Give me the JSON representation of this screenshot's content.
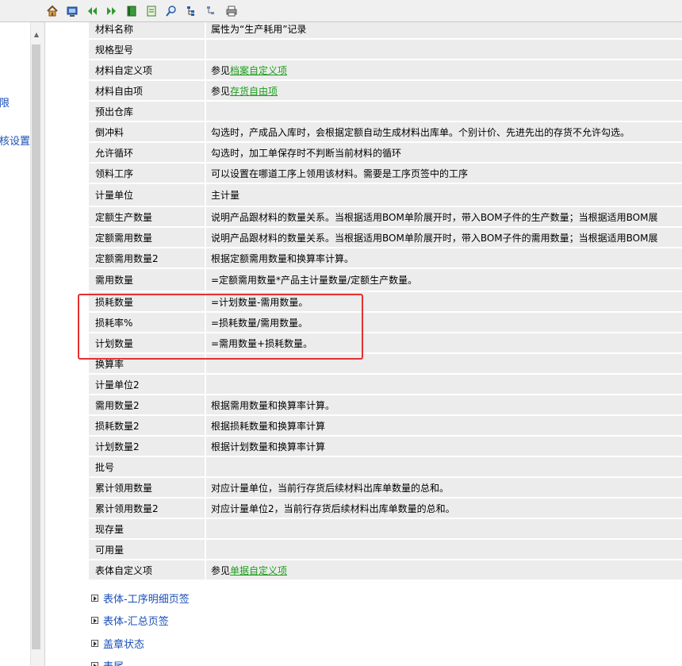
{
  "toolbar": {
    "buttons": [
      "home-icon",
      "contents-icon",
      "back-icon",
      "forward-icon",
      "book-icon",
      "page-icon",
      "search-icon",
      "tree-icon",
      "tree-collapse-icon",
      "print-icon"
    ]
  },
  "left_nav": {
    "fragment_1": "限",
    "fragment_2": "核设置"
  },
  "colors": {
    "link_green": "#1a9e1a",
    "link_blue": "#1a4fb8",
    "highlight_red": "#e53030",
    "row_bg": "#ececec"
  },
  "fields": [
    {
      "name": "材料名称",
      "desc": "属性为“生产耗用”记录"
    },
    {
      "name": "规格型号",
      "desc": ""
    },
    {
      "name": "材料自定义项",
      "desc_prefix": "参见",
      "link": "档案自定义项"
    },
    {
      "name": "材料自由项",
      "desc_prefix": "参见",
      "link": "存货自由项"
    },
    {
      "name": "预出仓库",
      "desc": ""
    },
    {
      "name": "倒冲料",
      "desc": "勾选时，产成品入库时，会根据定额自动生成材料出库单。个别计价、先进先出的存货不允许勾选。"
    },
    {
      "name": "允许循环",
      "desc": "勾选时，加工单保存时不判断当前材料的循环"
    },
    {
      "name": "领料工序",
      "desc": "可以设置在哪道工序上领用该材料。需要是工序页签中的工序"
    },
    {
      "name": "计量单位",
      "desc": "主计量"
    },
    {
      "name": "定额生产数量",
      "desc": "说明产品跟材料的数量关系。当根据适用BOM单阶展开时，带入BOM子件的生产数量；当根据适用BOM展"
    },
    {
      "name": "定额需用数量",
      "desc": "说明产品跟材料的数量关系。当根据适用BOM单阶展开时，带入BOM子件的需用数量；当根据适用BOM展"
    },
    {
      "name": "定额需用数量2",
      "desc": "根据定额需用数量和换算率计算。"
    },
    {
      "name": "需用数量",
      "desc": "=定额需用数量*产品主计量数量/定额生产数量。"
    },
    {
      "name": "损耗数量",
      "desc": "=计划数量-需用数量。"
    },
    {
      "name": "损耗率%",
      "desc": "=损耗数量/需用数量。"
    },
    {
      "name": "计划数量",
      "desc": "=需用数量+损耗数量。"
    },
    {
      "name": "换算率",
      "desc": ""
    },
    {
      "name": "计量单位2",
      "desc": ""
    },
    {
      "name": "需用数量2",
      "desc": "根据需用数量和换算率计算。"
    },
    {
      "name": "损耗数量2",
      "desc": "根据损耗数量和换算率计算"
    },
    {
      "name": "计划数量2",
      "desc": "根据计划数量和换算率计算"
    },
    {
      "name": "批号",
      "desc": ""
    },
    {
      "name": "累计领用数量",
      "desc": "对应计量单位，当前行存货后续材料出库单数量的总和。"
    },
    {
      "name": "累计领用数量2",
      "desc": "对应计量单位2，当前行存货后续材料出库单数量的总和。"
    },
    {
      "name": "现存量",
      "desc": ""
    },
    {
      "name": "可用量",
      "desc": ""
    },
    {
      "name": "表体自定义项",
      "desc_prefix": "参见",
      "link": "单据自定义项"
    }
  ],
  "sections": [
    {
      "label": "表体-工序明细页签"
    },
    {
      "label": "表体-汇总页签"
    },
    {
      "label": "盖章状态"
    },
    {
      "label": "表尾"
    }
  ]
}
